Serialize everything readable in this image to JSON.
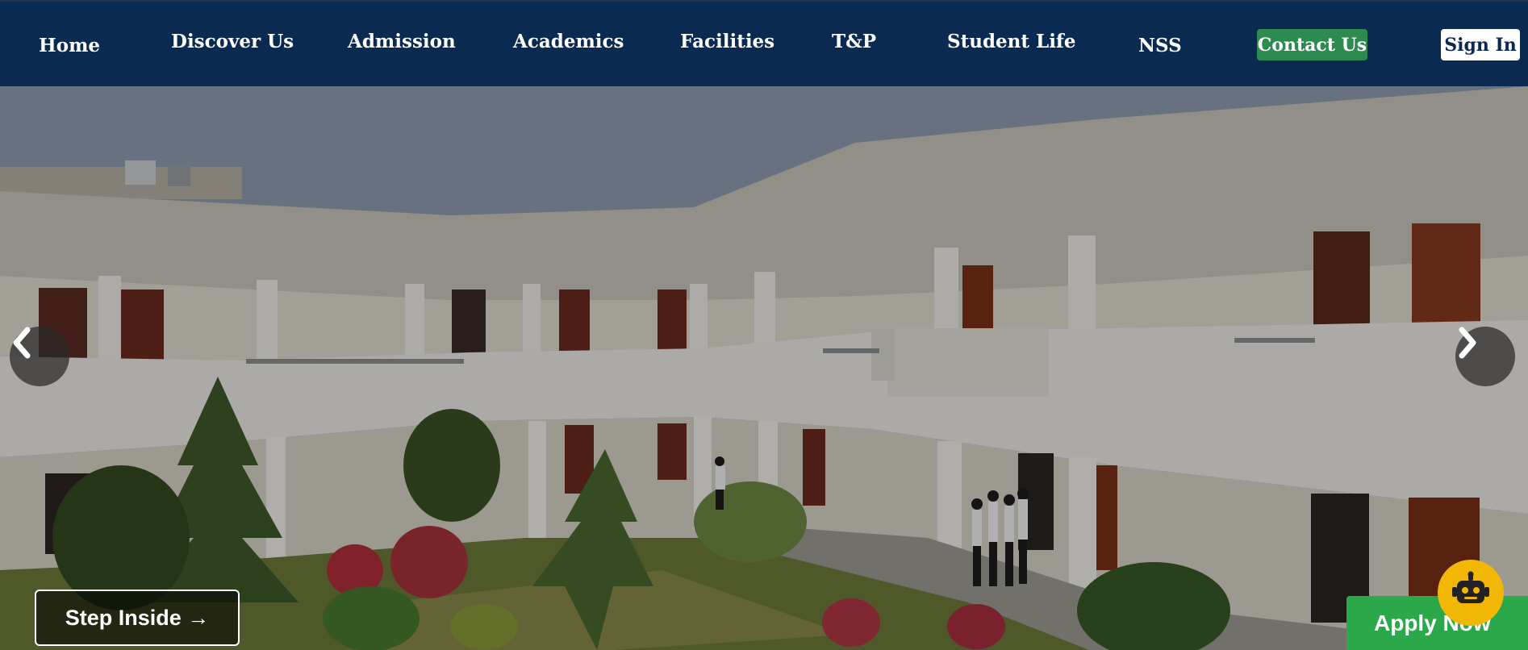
{
  "nav": {
    "items": [
      {
        "label": "Home"
      },
      {
        "label": "Discover Us"
      },
      {
        "label": "Admission"
      },
      {
        "label": "Academics"
      },
      {
        "label": "Facilities"
      },
      {
        "label": "T&P"
      },
      {
        "label": "Student Life"
      },
      {
        "label": "NSS"
      }
    ],
    "contact_label": "Contact Us",
    "signin_label": "Sign In"
  },
  "hero": {
    "prev_icon": "chevron-left-icon",
    "next_icon": "chevron-right-icon",
    "step_inside_label": "Step Inside →",
    "apply_label": "Apply Now",
    "chatbot_icon": "robot-icon"
  },
  "colors": {
    "nav_bg": "#0b2a52",
    "contact_bg": "#2e8b50",
    "apply_bg": "#2aa84a",
    "chatbot_bg": "#f2b705"
  }
}
